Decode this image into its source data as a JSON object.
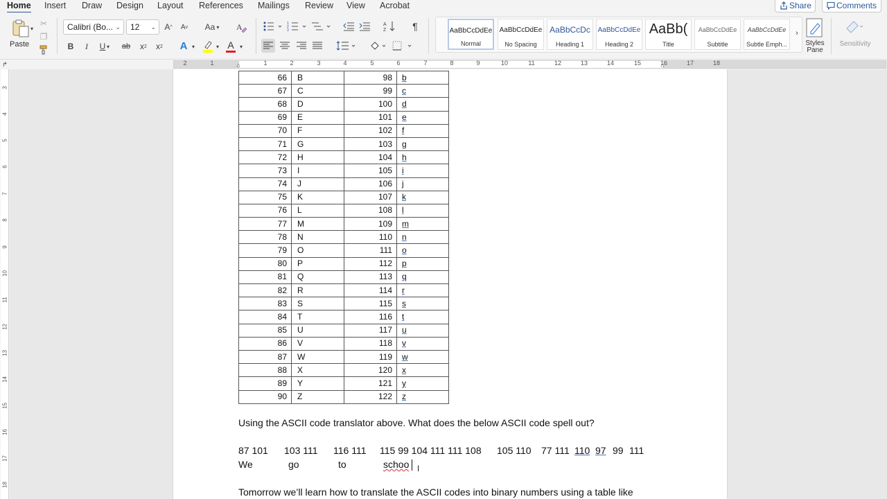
{
  "menu": {
    "tabs": [
      "Home",
      "Insert",
      "Draw",
      "Design",
      "Layout",
      "References",
      "Mailings",
      "Review",
      "View",
      "Acrobat"
    ],
    "active": "Home",
    "share_label": "Share",
    "comments_label": "Comments"
  },
  "ribbon": {
    "paste_label": "Paste",
    "font_name": "Calibri (Bo...",
    "font_size": "12",
    "bold": "B",
    "italic": "I",
    "underline": "U",
    "strike": "ab",
    "subscript": "x",
    "superscript": "x",
    "case_label": "Aa",
    "grow_font": "A",
    "shrink_font": "A",
    "font_color_label": "A",
    "text_effect_label": "A",
    "styles": [
      {
        "sample": "AaBbCcDdEe",
        "name": "Normal"
      },
      {
        "sample": "AaBbCcDdEe",
        "name": "No Spacing"
      },
      {
        "sample": "AaBbCcDc",
        "name": "Heading 1"
      },
      {
        "sample": "AaBbCcDdEe",
        "name": "Heading 2"
      },
      {
        "sample": "AaBb(",
        "name": "Title"
      },
      {
        "sample": "AaBbCcDdEe",
        "name": "Subtitle"
      },
      {
        "sample": "AaBbCcDdEe",
        "name": "Subtle Emph..."
      }
    ],
    "styles_pane_label": "Styles Pane",
    "sensitivity_label": "Sensitivity"
  },
  "ruler": {
    "numbers": [
      "2",
      "1",
      "1",
      "2",
      "3",
      "4",
      "5",
      "6",
      "7",
      "8",
      "9",
      "10",
      "11",
      "12",
      "13",
      "14",
      "15",
      "16",
      "17",
      "18"
    ]
  },
  "vruler": {
    "numbers": [
      "3",
      "4",
      "5",
      "6",
      "7",
      "8",
      "9",
      "10",
      "11",
      "12",
      "13",
      "14",
      "15",
      "16",
      "17",
      "18"
    ]
  },
  "table": {
    "rows": [
      [
        "66",
        "B",
        "98",
        "b"
      ],
      [
        "67",
        "C",
        "99",
        "c"
      ],
      [
        "68",
        "D",
        "100",
        "d"
      ],
      [
        "69",
        "E",
        "101",
        "e"
      ],
      [
        "70",
        "F",
        "102",
        "f"
      ],
      [
        "71",
        "G",
        "103",
        "g"
      ],
      [
        "72",
        "H",
        "104",
        "h"
      ],
      [
        "73",
        "I",
        "105",
        "i"
      ],
      [
        "74",
        "J",
        "106",
        "j"
      ],
      [
        "75",
        "K",
        "107",
        "k"
      ],
      [
        "76",
        "L",
        "108",
        "l"
      ],
      [
        "77",
        "M",
        "109",
        "m"
      ],
      [
        "78",
        "N",
        "110",
        "n"
      ],
      [
        "79",
        "O",
        "111",
        "o"
      ],
      [
        "80",
        "P",
        "112",
        "p"
      ],
      [
        "81",
        "Q",
        "113",
        "q"
      ],
      [
        "82",
        "R",
        "114",
        "r"
      ],
      [
        "83",
        "S",
        "115",
        "s"
      ],
      [
        "84",
        "T",
        "116",
        "t"
      ],
      [
        "85",
        "U",
        "117",
        "u"
      ],
      [
        "86",
        "V",
        "118",
        "v"
      ],
      [
        "87",
        "W",
        "119",
        "w"
      ],
      [
        "88",
        "X",
        "120",
        "x"
      ],
      [
        "89",
        "Y",
        "121",
        "y"
      ],
      [
        "90",
        "Z",
        "122",
        "z"
      ]
    ]
  },
  "document": {
    "question": "Using the ASCII code translator above. What does the below ASCII code spell out?",
    "codes": {
      "w1": "87 101",
      "w2": "103 111",
      "w3": "116 111",
      "w4": "115 99 104 111 111 108",
      "w5": "105 110",
      "w6a": "77 111",
      "w6b": "110",
      "w6c": "97",
      "w6d": "99",
      "w6e": "111"
    },
    "answers": {
      "a1": "We",
      "a2": "go",
      "a3": "to",
      "a4": "schoo"
    },
    "tomorrow": "Tomorrow we’ll learn how to translate the ASCII codes into binary numbers using a table like"
  }
}
